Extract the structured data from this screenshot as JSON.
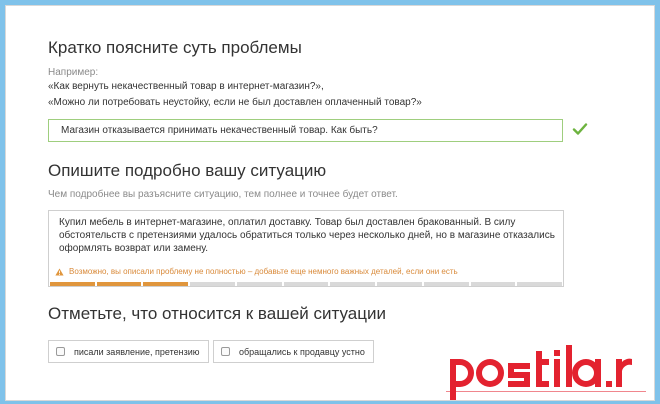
{
  "section1": {
    "title": "Кратко поясните суть проблемы",
    "hint": "Например:",
    "examples": [
      "«Как вернуть некачественный товар в интернет-магазин?»,",
      "«Можно ли потребовать неустойку, если не был доставлен оплаченный товар?»"
    ],
    "input_value": "Магазин отказывается принимать некачественный товар. Как быть?",
    "valid_icon": "check-icon"
  },
  "section2": {
    "title": "Опишите подробно вашу ситуацию",
    "hint": "Чем подробнее вы разъясните ситуацию, тем полнее и точнее будет ответ.",
    "textarea_value": "Купил мебель в интернет-магазине, оплатил доставку. Товар был доставлен бракованный. В силу обстоятельств с претензиями удалось обратиться только через несколько дней, но в магазине отказались оформлять возврат или замену.",
    "warning": "Возможно, вы описали проблему не полностью – добавьте еще немного важных деталей, если они есть",
    "warning_icon": "warning-triangle-icon",
    "progress": {
      "filled_segments": 3,
      "total_segments": 11
    },
    "colors": {
      "progress_filled": "#e0963d",
      "progress_empty": "#d9d9d9",
      "warning": "#d98a3a"
    }
  },
  "section3": {
    "title": "Отметьте, что относится к вашей ситуации",
    "options": [
      {
        "label": "писали заявление, претензию",
        "checked": false
      },
      {
        "label": "обращались к продавцу устно",
        "checked": false
      }
    ]
  },
  "watermark": {
    "text": "postila.ru",
    "color": "#e3222f"
  },
  "colors": {
    "background": "#7fc2ea",
    "valid_border": "#9fce7e",
    "check": "#6db33f"
  }
}
